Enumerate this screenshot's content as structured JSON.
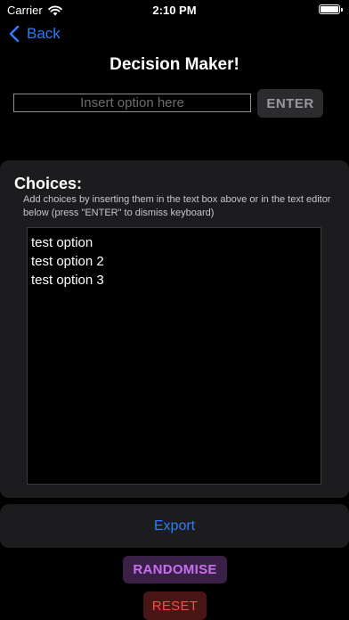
{
  "status_bar": {
    "carrier": "Carrier",
    "time": "2:10 PM"
  },
  "nav": {
    "back_label": "Back"
  },
  "title": "Decision Maker!",
  "option_input": {
    "placeholder": "Insert option here",
    "value": ""
  },
  "enter_label": "ENTER",
  "choices": {
    "heading": "Choices:",
    "help_text": "Add choices by inserting them in the text box above or in the text editor below (press \"ENTER\" to dismiss keyboard)",
    "editor_text": "test option\ntest option 2\ntest option 3"
  },
  "export_label": "Export",
  "randomise_label": "RANDOMISE",
  "reset_label": "RESET",
  "colors": {
    "background": "#000000",
    "panel": "#1c1c1e",
    "accent_blue": "#2f7cf6",
    "randomise_text": "#c76ff0",
    "randomise_bg": "#3a1f46",
    "reset_text": "#ff4a45",
    "reset_bg": "#4a1515"
  },
  "icons": {
    "wifi": "wifi-icon",
    "battery": "battery-icon",
    "back": "chevron-left-icon"
  }
}
